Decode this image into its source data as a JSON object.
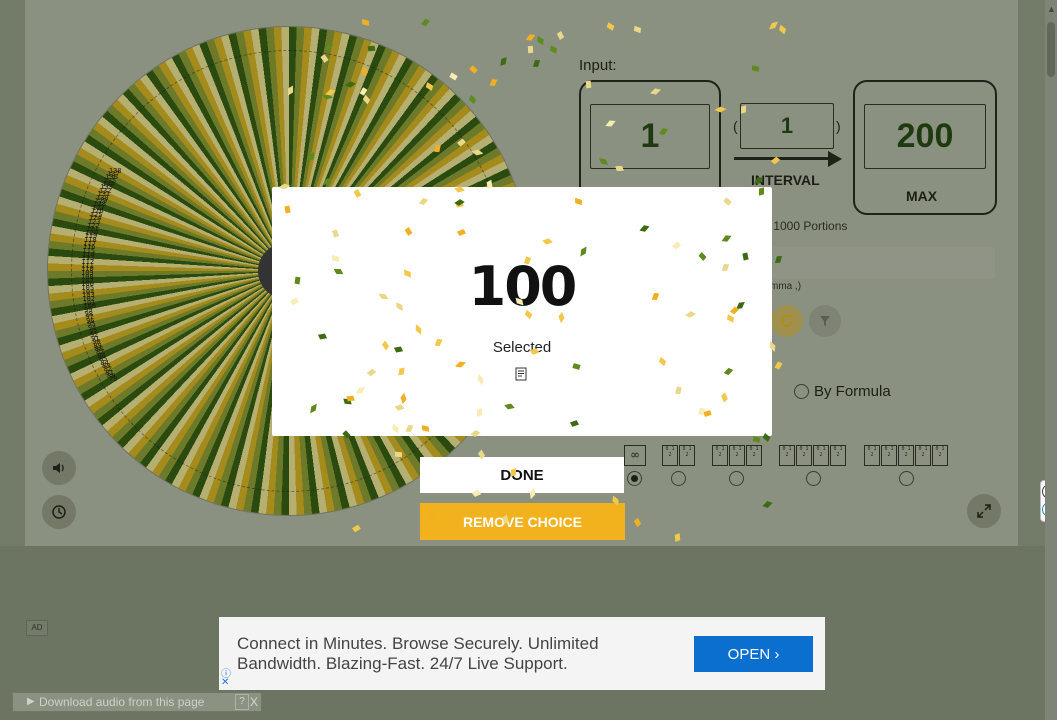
{
  "input": {
    "title": "Input:",
    "min_value": "1",
    "interval_value": "1",
    "interval_open": "(",
    "interval_close": ")",
    "interval_label": "INTERVAL",
    "max_value": "200",
    "max_label": "MAX",
    "portions_text": "m 1000 Portions",
    "comma_hint": "mma ,)",
    "by_formula_label": "By Formula"
  },
  "wheel": {
    "labels": [
      "79",
      "80",
      "81",
      "82",
      "83",
      "84",
      "85",
      "86",
      "87",
      "88",
      "89",
      "90",
      "91",
      "92",
      "93",
      "94",
      "95",
      "96",
      "97",
      "98",
      "99",
      "100",
      "101",
      "102",
      "103",
      "104",
      "105",
      "106",
      "107",
      "108",
      "109",
      "110",
      "111",
      "112",
      "113",
      "114",
      "115",
      "116",
      "117",
      "118",
      "119",
      "120",
      "121",
      "122",
      "123",
      "124",
      "125",
      "126",
      "127",
      "128",
      "129",
      "130",
      "131",
      "132",
      "133",
      "134",
      "135",
      "136",
      "137",
      "138"
    ]
  },
  "digits": {
    "infinity": "∞",
    "digit_label": "0 1 2"
  },
  "modal": {
    "result": "100",
    "selected_label": "Selected",
    "done_label": "DONE",
    "remove_label": "REMOVE CHOICE"
  },
  "ad": {
    "badge": "AD",
    "text": "Connect in Minutes. Browse Securely. Unlimited Bandwidth. Blazing-Fast. 24/7 Live Support.",
    "open_label": "OPEN ›",
    "info_icon": "ⓘ",
    "close_icon": "✕"
  },
  "download_bar": {
    "text": "Download audio from this page",
    "help": "?",
    "close": "X"
  },
  "colors": {
    "accent": "#f2b21d",
    "ad_button": "#0b6fd0"
  }
}
